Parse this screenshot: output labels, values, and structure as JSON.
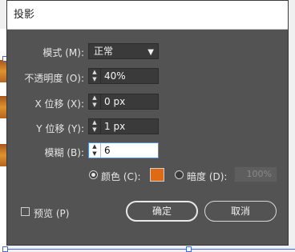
{
  "dialog": {
    "title": "投影",
    "mode": {
      "label": "模式 (M):",
      "value": "正常"
    },
    "opacity": {
      "label": "不透明度 (O):",
      "value": "40%"
    },
    "x_offset": {
      "label": "X 位移 (X):",
      "value": "0 px"
    },
    "y_offset": {
      "label": "Y 位移 (Y):",
      "value": "1 px"
    },
    "blur": {
      "label": "模糊 (B):",
      "value": "6"
    },
    "color_option": {
      "label": "颜色 (C):",
      "selected": true,
      "swatch": "#de6a14"
    },
    "darkness_option": {
      "label": "暗度 (D):",
      "selected": false,
      "value": "100%"
    },
    "preview": {
      "label": "预览 (P)",
      "checked": false
    },
    "buttons": {
      "ok": "确定",
      "cancel": "取消"
    }
  }
}
